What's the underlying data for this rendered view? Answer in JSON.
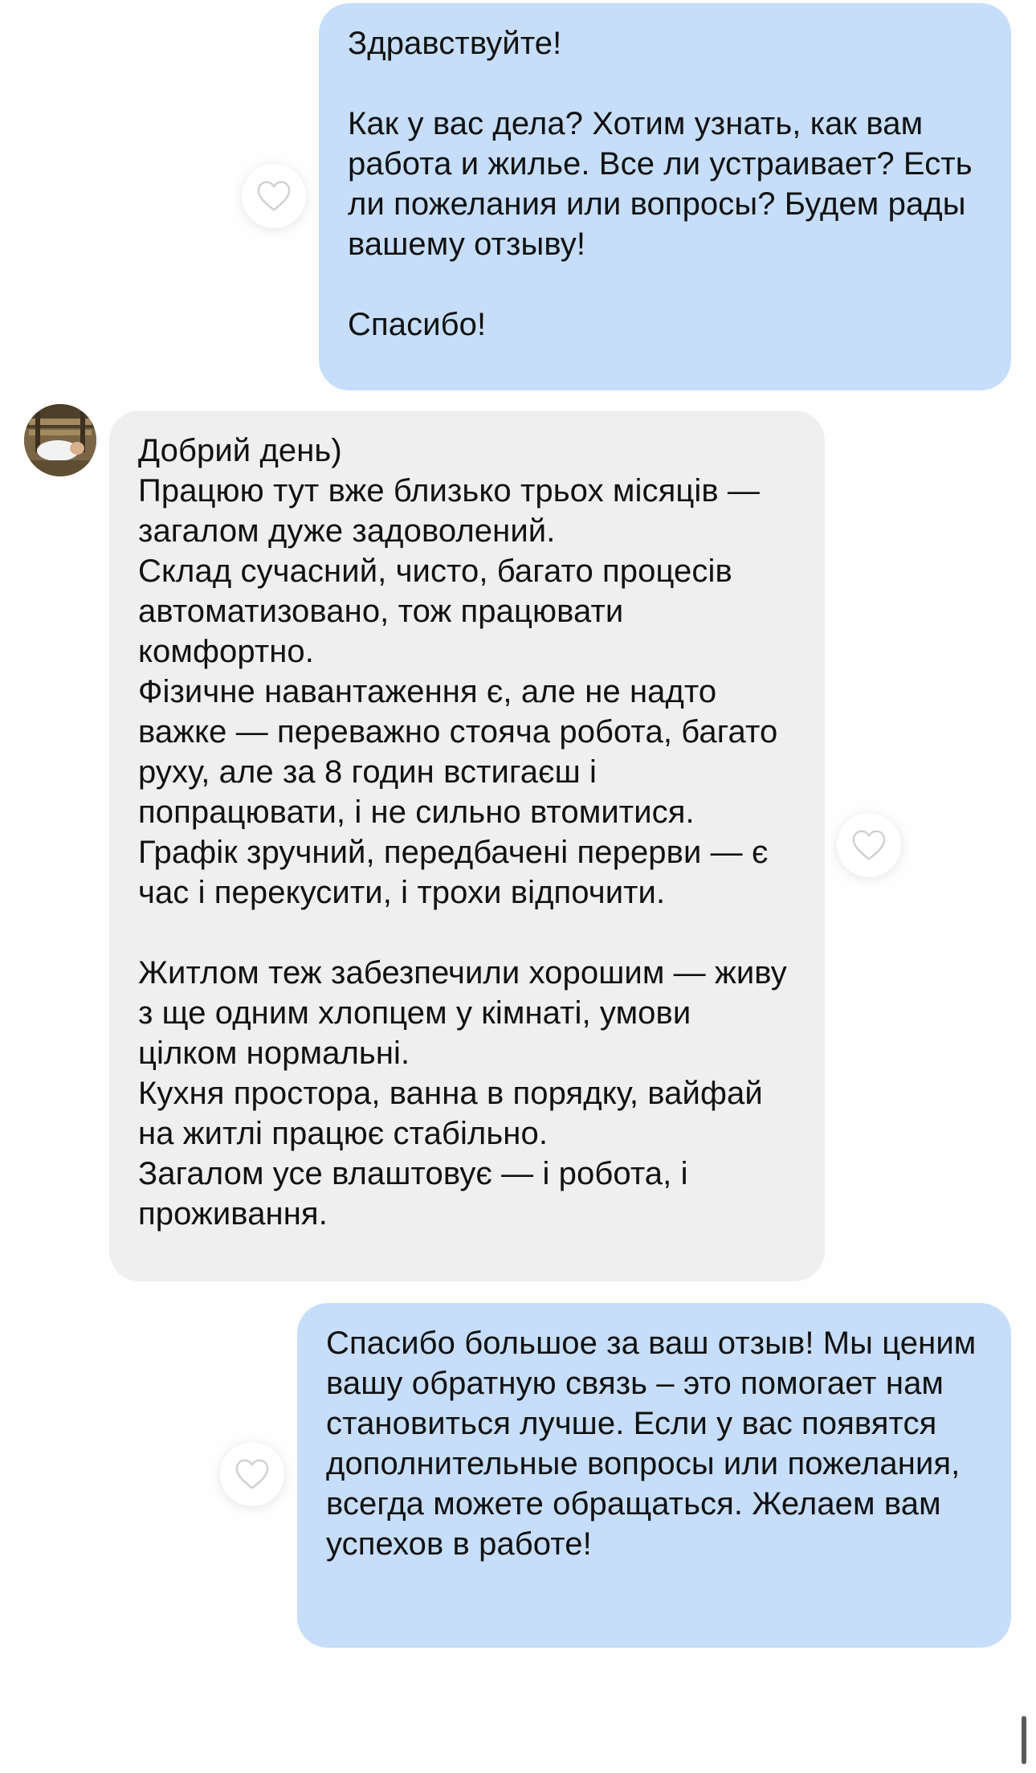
{
  "messages": [
    {
      "id": "msg1",
      "direction": "outgoing",
      "text": "Здравствуйте!\n\nКак у вас дела? Хотим узнать, как вам работа и жилье. Все ли устраивает? Есть ли пожелания или вопросы? Будем рады вашему отзыву!\n\nСпасибо!"
    },
    {
      "id": "msg2",
      "direction": "incoming",
      "text": "Добрий день)\nПрацюю тут вже близько трьох місяців — загалом дуже задоволений.\nСклад сучасний, чисто, багато процесів автоматизовано, тож працювати комфортно.\nФізичне навантаження є, але не надто важке — переважно стояча робота, багато руху, але за 8 годин встигаєш і попрацювати, і не сильно втомитися.\nГрафік зручний, передбачені перерви — є час і перекусити, і трохи відпочити.\n\nЖитлом теж забезпечили хорошим — живу з ще одним хлопцем у кімнаті, умови цілком нормальні.\nКухня простора, ванна в порядку, вайфай на житлі працює стабільно.\nЗагалом усе влаштовує — і робота, і проживання."
    },
    {
      "id": "msg3",
      "direction": "outgoing",
      "text": "Спасибо большое за ваш отзыв! Мы ценим вашу обратную связь – это помогает нам становиться лучше. Если у вас появятся дополнительные вопросы или пожелания, всегда можете обращаться. Желаем вам успехов в работе!"
    }
  ],
  "icons": {
    "like": "heart-outline-icon",
    "avatar": "user-avatar"
  },
  "colors": {
    "outgoing_bubble": "#c6defa",
    "incoming_bubble": "#efefef",
    "heart_stroke": "#cfcfcf",
    "background": "#fefefe"
  }
}
